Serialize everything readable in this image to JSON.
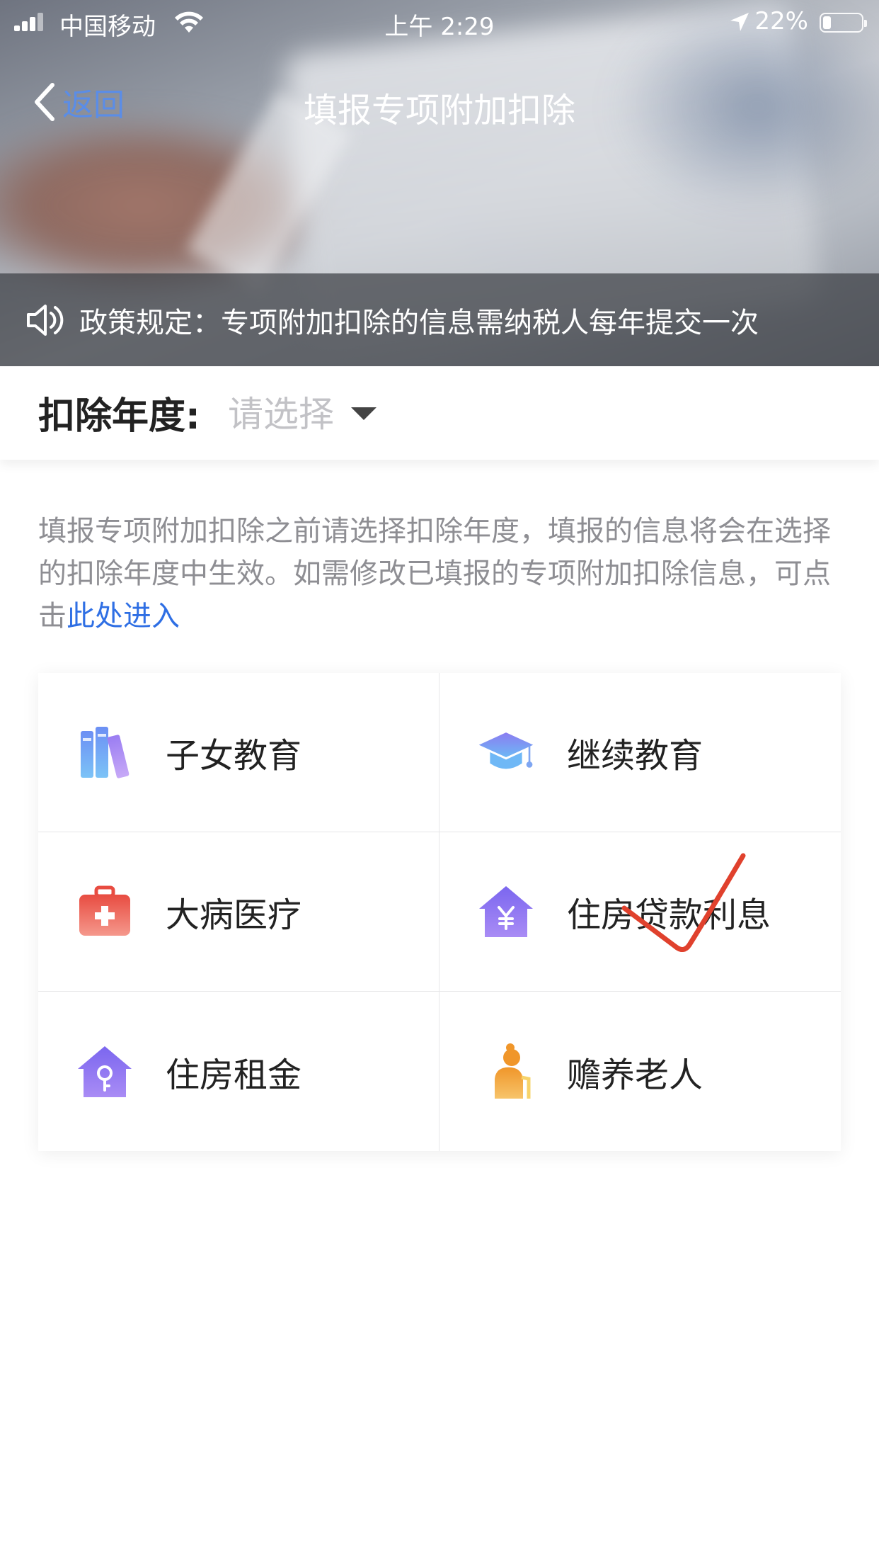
{
  "status_bar": {
    "carrier": "中国移动",
    "time": "上午 2:29",
    "battery_percent": "22%",
    "battery_level": 0.22
  },
  "nav": {
    "back_label": "返回",
    "title": "填报专项附加扣除"
  },
  "notice": {
    "text": "政策规定：专项附加扣除的信息需纳税人每年提交一次"
  },
  "year_selector": {
    "label": "扣除年度:",
    "placeholder": "请选择"
  },
  "description": {
    "text": "填报专项附加扣除之前请选择扣除年度，填报的信息将会在选择的扣除年度中生效。如需修改已填报的专项附加扣除信息，可点击",
    "link_text": "此处进入"
  },
  "categories": [
    {
      "label": "子女教育",
      "icon": "books-icon",
      "color": "#6f9ff5"
    },
    {
      "label": "继续教育",
      "icon": "graduation-cap-icon",
      "color": "#7f8ff0"
    },
    {
      "label": "大病医疗",
      "icon": "medical-kit-icon",
      "color": "#ea5b50"
    },
    {
      "label": "住房贷款利息",
      "icon": "house-yuan-icon",
      "color": "#8a6cf0"
    },
    {
      "label": "住房租金",
      "icon": "house-key-icon",
      "color": "#8a6cf0"
    },
    {
      "label": "赡养老人",
      "icon": "elderly-person-icon",
      "color": "#f0a030"
    }
  ],
  "annotation": {
    "icon": "red-checkmark-icon",
    "color": "#e0412d"
  }
}
